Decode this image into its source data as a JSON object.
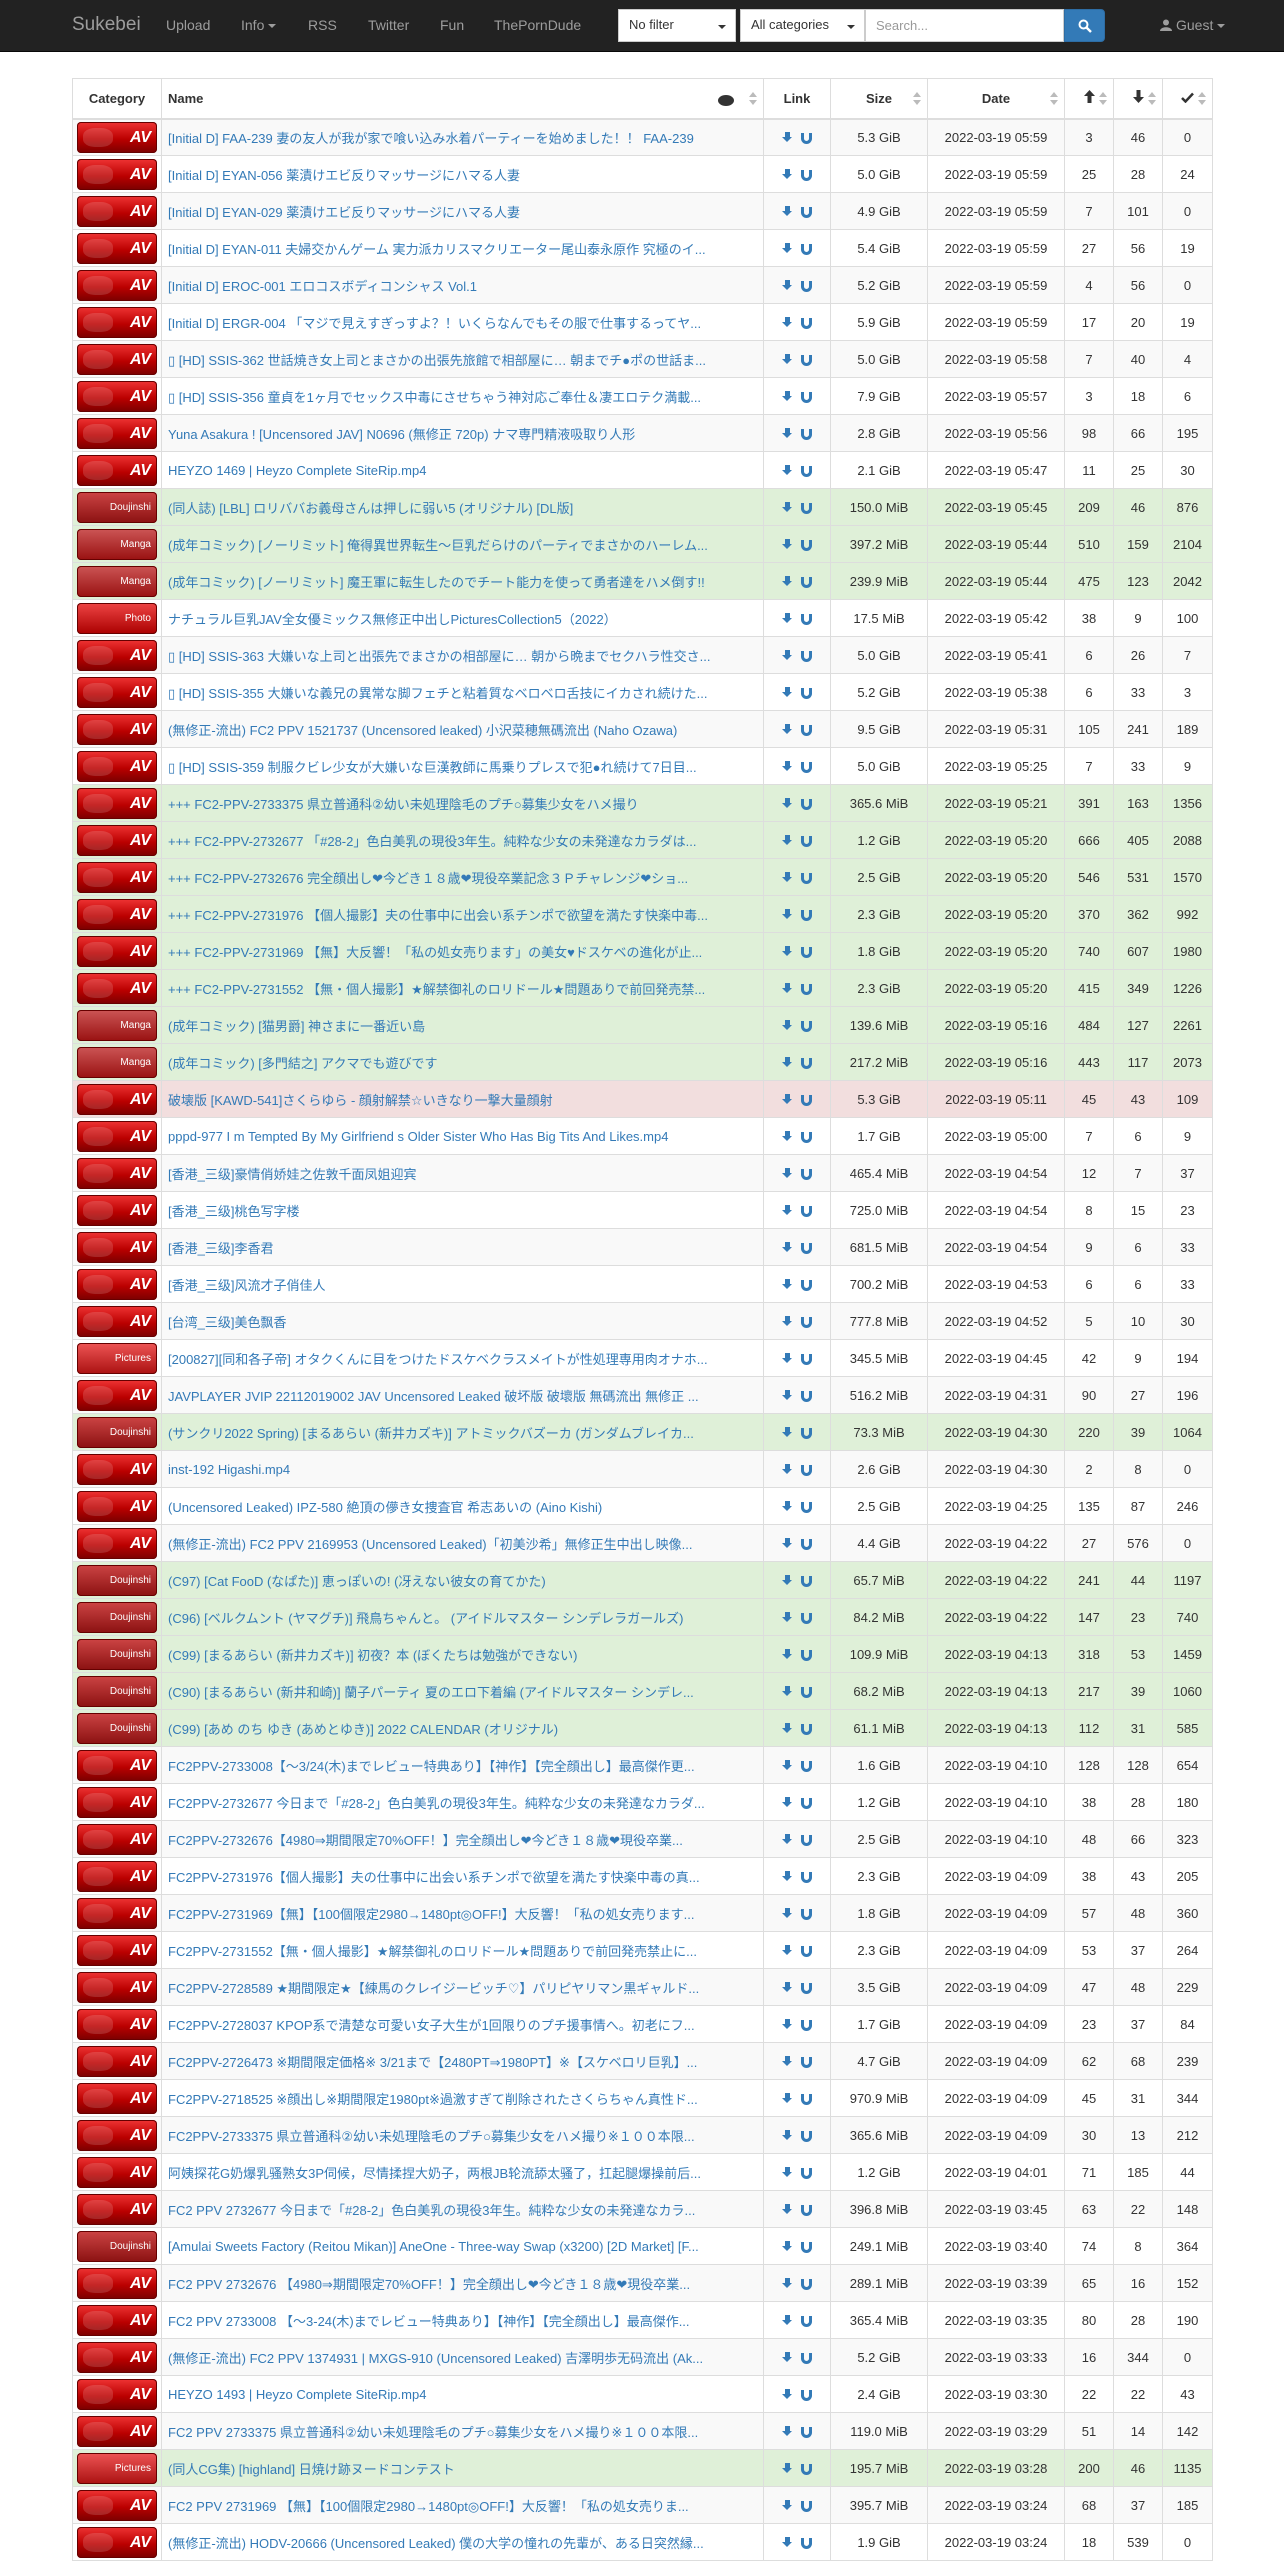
{
  "nav": {
    "brand": "Sukebei",
    "items": [
      "Upload",
      "Info",
      "RSS",
      "Twitter",
      "Fun",
      "ThePornDude"
    ],
    "filter": "No filter",
    "category": "All categories",
    "search_placeholder": "Search...",
    "user": "Guest"
  },
  "table": {
    "headers": {
      "category": "Category",
      "name": "Name",
      "link": "Link",
      "size": "Size",
      "date": "Date"
    },
    "rows": [
      {
        "cat": "AV",
        "name": "[Initial D] FAA-239 妻の友人が我が家で喰い込み水着パーティーを始めました！！ FAA-239",
        "size": "5.3 GiB",
        "date": "2022-03-19 05:59",
        "s": "3",
        "l": "46",
        "c": "0",
        "st": ""
      },
      {
        "cat": "AV",
        "name": "[Initial D] EYAN-056 薬漬けエビ反りマッサージにハマる人妻",
        "size": "5.0 GiB",
        "date": "2022-03-19 05:59",
        "s": "25",
        "l": "28",
        "c": "24",
        "st": ""
      },
      {
        "cat": "AV",
        "name": "[Initial D] EYAN-029 薬漬けエビ反りマッサージにハマる人妻",
        "size": "4.9 GiB",
        "date": "2022-03-19 05:59",
        "s": "7",
        "l": "101",
        "c": "0",
        "st": ""
      },
      {
        "cat": "AV",
        "name": "[Initial D] EYAN-011 夫婦交かんゲーム 実力派カリスマクリエーター尾山泰永原作 究極のイ...",
        "size": "5.4 GiB",
        "date": "2022-03-19 05:59",
        "s": "27",
        "l": "56",
        "c": "19",
        "st": ""
      },
      {
        "cat": "AV",
        "name": "[Initial D] EROC-001 エロコスボディコンシャス Vol.1",
        "size": "5.2 GiB",
        "date": "2022-03-19 05:59",
        "s": "4",
        "l": "56",
        "c": "0",
        "st": ""
      },
      {
        "cat": "AV",
        "name": "[Initial D] ERGR-004 「マジで見えすぎっすよ？！いくらなんでもその服で仕事するってヤ...",
        "size": "5.9 GiB",
        "date": "2022-03-19 05:59",
        "s": "17",
        "l": "20",
        "c": "19",
        "st": ""
      },
      {
        "cat": "AV",
        "name": "▯ [HD] SSIS-362 世話焼き女上司とまさかの出張先旅館で相部屋に… 朝までチ●ポの世話ま...",
        "size": "5.0 GiB",
        "date": "2022-03-19 05:58",
        "s": "7",
        "l": "40",
        "c": "4",
        "st": ""
      },
      {
        "cat": "AV",
        "name": "▯ [HD] SSIS-356 童貞を1ヶ月でセックス中毒にさせちゃう神対応ご奉仕＆凄エロテク満載...",
        "size": "7.9 GiB",
        "date": "2022-03-19 05:57",
        "s": "3",
        "l": "18",
        "c": "6",
        "st": ""
      },
      {
        "cat": "AV",
        "name": "Yuna Asakura ! [Uncensored JAV] N0696 (無修正 720p) ナマ専門精液吸取り人形",
        "size": "2.8 GiB",
        "date": "2022-03-19 05:56",
        "s": "98",
        "l": "66",
        "c": "195",
        "st": ""
      },
      {
        "cat": "AV",
        "name": "HEYZO 1469 | Heyzo Complete SiteRip.mp4",
        "size": "2.1 GiB",
        "date": "2022-03-19 05:47",
        "s": "11",
        "l": "25",
        "c": "30",
        "st": ""
      },
      {
        "cat": "Doujinshi",
        "name": "(同人誌) [LBL] ロリババお義母さんは押しに弱い5 (オリジナル) [DL版]",
        "size": "150.0 MiB",
        "date": "2022-03-19 05:45",
        "s": "209",
        "l": "46",
        "c": "876",
        "st": "success"
      },
      {
        "cat": "Manga",
        "name": "(成年コミック) [ノーリミット] 俺得異世界転生～巨乳だらけのパーティでまさかのハーレム...",
        "size": "397.2 MiB",
        "date": "2022-03-19 05:44",
        "s": "510",
        "l": "159",
        "c": "2104",
        "st": "success"
      },
      {
        "cat": "Manga",
        "name": "(成年コミック) [ノーリミット] 魔王軍に転生したのでチート能力を使って勇者達をハメ倒す!!",
        "size": "239.9 MiB",
        "date": "2022-03-19 05:44",
        "s": "475",
        "l": "123",
        "c": "2042",
        "st": "success"
      },
      {
        "cat": "Photo",
        "name": "ナチュラル巨乳JAV全女優ミックス無修正中出しPicturesCollection5（2022）",
        "size": "17.5 MiB",
        "date": "2022-03-19 05:42",
        "s": "38",
        "l": "9",
        "c": "100",
        "st": ""
      },
      {
        "cat": "AV",
        "name": "▯ [HD] SSIS-363 大嫌いな上司と出張先でまさかの相部屋に… 朝から晩までセクハラ性交さ...",
        "size": "5.0 GiB",
        "date": "2022-03-19 05:41",
        "s": "6",
        "l": "26",
        "c": "7",
        "st": ""
      },
      {
        "cat": "AV",
        "name": "▯ [HD] SSIS-355 大嫌いな義兄の異常な脚フェチと粘着質なベロベロ舌技にイカされ続けた...",
        "size": "5.2 GiB",
        "date": "2022-03-19 05:38",
        "s": "6",
        "l": "33",
        "c": "3",
        "st": ""
      },
      {
        "cat": "AV",
        "name": "(無修正-流出) FC2 PPV 1521737 (Uncensored leaked) 小沢菜穂無碼流出 (Naho Ozawa)",
        "size": "9.5 GiB",
        "date": "2022-03-19 05:31",
        "s": "105",
        "l": "241",
        "c": "189",
        "st": ""
      },
      {
        "cat": "AV",
        "name": "▯ [HD] SSIS-359 制服クビレ少女が大嫌いな巨漢教師に馬乗りプレスで犯●れ続けて7日目...",
        "size": "5.0 GiB",
        "date": "2022-03-19 05:25",
        "s": "7",
        "l": "33",
        "c": "9",
        "st": ""
      },
      {
        "cat": "AV",
        "name": "+++ FC2-PPV-2733375 県立普通科②幼い未処理陰毛のプチ○募集少女をハメ撮り",
        "size": "365.6 MiB",
        "date": "2022-03-19 05:21",
        "s": "391",
        "l": "163",
        "c": "1356",
        "st": "success"
      },
      {
        "cat": "AV",
        "name": "+++ FC2-PPV-2732677 「#28-2」色白美乳の現役3年生。純粋な少女の未発達なカラダは...",
        "size": "1.2 GiB",
        "date": "2022-03-19 05:20",
        "s": "666",
        "l": "405",
        "c": "2088",
        "st": "success"
      },
      {
        "cat": "AV",
        "name": "+++ FC2-PPV-2732676 完全顔出し❤今どき１８歳❤現役卒業記念３Ｐチャレンジ❤ショ...",
        "size": "2.5 GiB",
        "date": "2022-03-19 05:20",
        "s": "546",
        "l": "531",
        "c": "1570",
        "st": "success"
      },
      {
        "cat": "AV",
        "name": "+++ FC2-PPV-2731976 【個人撮影】夫の仕事中に出会い系チンポで欲望を満たす快楽中毒...",
        "size": "2.3 GiB",
        "date": "2022-03-19 05:20",
        "s": "370",
        "l": "362",
        "c": "992",
        "st": "success"
      },
      {
        "cat": "AV",
        "name": "+++ FC2-PPV-2731969 【無】大反響！「私の処女売ります」の美女♥ドスケベの進化が止...",
        "size": "1.8 GiB",
        "date": "2022-03-19 05:20",
        "s": "740",
        "l": "607",
        "c": "1980",
        "st": "success"
      },
      {
        "cat": "AV",
        "name": "+++ FC2-PPV-2731552 【無・個人撮影】★解禁御礼のロリドール★問題ありで前回発売禁...",
        "size": "2.3 GiB",
        "date": "2022-03-19 05:20",
        "s": "415",
        "l": "349",
        "c": "1226",
        "st": "success"
      },
      {
        "cat": "Manga",
        "name": "(成年コミック) [猫男爵] 神さまに一番近い島",
        "size": "139.6 MiB",
        "date": "2022-03-19 05:16",
        "s": "484",
        "l": "127",
        "c": "2261",
        "st": "success"
      },
      {
        "cat": "Manga",
        "name": "(成年コミック) [多門結之] アクマでも遊びです",
        "size": "217.2 MiB",
        "date": "2022-03-19 05:16",
        "s": "443",
        "l": "117",
        "c": "2073",
        "st": "success"
      },
      {
        "cat": "AV",
        "name": "破壊版 [KAWD-541]さくらゆら - 顔射解禁☆いきなり一撃大量顔射",
        "size": "5.3 GiB",
        "date": "2022-03-19 05:11",
        "s": "45",
        "l": "43",
        "c": "109",
        "st": "danger"
      },
      {
        "cat": "AV",
        "name": "pppd-977 I m Tempted By My Girlfriend s Older Sister Who Has Big Tits And Likes.mp4",
        "size": "1.7 GiB",
        "date": "2022-03-19 05:00",
        "s": "7",
        "l": "6",
        "c": "9",
        "st": ""
      },
      {
        "cat": "AV",
        "name": "[香港_三级]豪情俏娇娃之佐敦千面凤姐迎宾",
        "size": "465.4 MiB",
        "date": "2022-03-19 04:54",
        "s": "12",
        "l": "7",
        "c": "37",
        "st": ""
      },
      {
        "cat": "AV",
        "name": "[香港_三级]桃色写字楼",
        "size": "725.0 MiB",
        "date": "2022-03-19 04:54",
        "s": "8",
        "l": "15",
        "c": "23",
        "st": ""
      },
      {
        "cat": "AV",
        "name": "[香港_三级]李香君",
        "size": "681.5 MiB",
        "date": "2022-03-19 04:54",
        "s": "9",
        "l": "6",
        "c": "33",
        "st": ""
      },
      {
        "cat": "AV",
        "name": "[香港_三级]风流才子俏佳人",
        "size": "700.2 MiB",
        "date": "2022-03-19 04:53",
        "s": "6",
        "l": "6",
        "c": "33",
        "st": ""
      },
      {
        "cat": "AV",
        "name": "[台湾_三级]美色飘香",
        "size": "777.8 MiB",
        "date": "2022-03-19 04:52",
        "s": "5",
        "l": "10",
        "c": "30",
        "st": ""
      },
      {
        "cat": "Pictures",
        "name": "[200827][同和各子帝] オタクくんに目をつけたドスケベクラスメイトが性処理専用肉オナホ...",
        "size": "345.5 MiB",
        "date": "2022-03-19 04:45",
        "s": "42",
        "l": "9",
        "c": "194",
        "st": ""
      },
      {
        "cat": "AV",
        "name": "JAVPLAYER JVIP 22112019002 JAV Uncensored Leaked 破坏版 破壞版 無碼流出 無修正 ...",
        "size": "516.2 MiB",
        "date": "2022-03-19 04:31",
        "s": "90",
        "l": "27",
        "c": "196",
        "st": ""
      },
      {
        "cat": "Doujinshi",
        "name": "(サンクリ2022 Spring) [まるあらい (新井カズキ)] アトミックバズーカ (ガンダムブレイカ...",
        "size": "73.3 MiB",
        "date": "2022-03-19 04:30",
        "s": "220",
        "l": "39",
        "c": "1064",
        "st": "success"
      },
      {
        "cat": "AV",
        "name": "inst-192 Higashi.mp4",
        "size": "2.6 GiB",
        "date": "2022-03-19 04:30",
        "s": "2",
        "l": "8",
        "c": "0",
        "st": ""
      },
      {
        "cat": "AV",
        "name": "(Uncensored Leaked) IPZ-580 絶頂の儚き女捜査官 希志あいの (Aino Kishi)",
        "size": "2.5 GiB",
        "date": "2022-03-19 04:25",
        "s": "135",
        "l": "87",
        "c": "246",
        "st": ""
      },
      {
        "cat": "AV",
        "name": "(無修正-流出) FC2 PPV 2169953 (Uncensored Leaked)「初美沙希」無修正生中出し映像...",
        "size": "4.4 GiB",
        "date": "2022-03-19 04:22",
        "s": "27",
        "l": "576",
        "c": "0",
        "st": ""
      },
      {
        "cat": "Doujinshi",
        "name": "(C97) [Cat FooD (なぱた)] 恵っぽいの! (冴えない彼女の育てかた)",
        "size": "65.7 MiB",
        "date": "2022-03-19 04:22",
        "s": "241",
        "l": "44",
        "c": "1197",
        "st": "success"
      },
      {
        "cat": "Doujinshi",
        "name": "(C96) [ベルクムント (ヤマグチ)] 飛鳥ちゃんと。 (アイドルマスター シンデレラガールズ)",
        "size": "84.2 MiB",
        "date": "2022-03-19 04:22",
        "s": "147",
        "l": "23",
        "c": "740",
        "st": "success"
      },
      {
        "cat": "Doujinshi",
        "name": "(C99) [まるあらい (新井カズキ)] 初夜？本 (ぼくたちは勉強ができない)",
        "size": "109.9 MiB",
        "date": "2022-03-19 04:13",
        "s": "318",
        "l": "53",
        "c": "1459",
        "st": "success"
      },
      {
        "cat": "Doujinshi",
        "name": "(C90) [まるあらい (新井和崎)] 蘭子パーティ 夏のエロ下着編 (アイドルマスター シンデレ...",
        "size": "68.2 MiB",
        "date": "2022-03-19 04:13",
        "s": "217",
        "l": "39",
        "c": "1060",
        "st": "success"
      },
      {
        "cat": "Doujinshi",
        "name": "(C99) [あめ のち ゆき (あめとゆき)] 2022 CALENDAR (オリジナル)",
        "size": "61.1 MiB",
        "date": "2022-03-19 04:13",
        "s": "112",
        "l": "31",
        "c": "585",
        "st": "success"
      },
      {
        "cat": "AV",
        "name": "FC2PPV-2733008【〜3/24(木)までレビュー特典あり】【神作】【完全顔出し】最高傑作更...",
        "size": "1.6 GiB",
        "date": "2022-03-19 04:10",
        "s": "128",
        "l": "128",
        "c": "654",
        "st": ""
      },
      {
        "cat": "AV",
        "name": "FC2PPV-2732677 今日まで「#28-2」色白美乳の現役3年生。純粋な少女の未発達なカラダ...",
        "size": "1.2 GiB",
        "date": "2022-03-19 04:10",
        "s": "38",
        "l": "28",
        "c": "180",
        "st": ""
      },
      {
        "cat": "AV",
        "name": "FC2PPV-2732676【4980⇒期間限定70%OFF！】完全顔出し❤今どき１８歳❤現役卒業...",
        "size": "2.5 GiB",
        "date": "2022-03-19 04:10",
        "s": "48",
        "l": "66",
        "c": "323",
        "st": ""
      },
      {
        "cat": "AV",
        "name": "FC2PPV-2731976【個人撮影】夫の仕事中に出会い系チンポで欲望を満たす快楽中毒の真...",
        "size": "2.3 GiB",
        "date": "2022-03-19 04:09",
        "s": "38",
        "l": "43",
        "c": "205",
        "st": ""
      },
      {
        "cat": "AV",
        "name": "FC2PPV-2731969【無】【100個限定2980→1480pt◎OFF!】大反響！「私の処女売ります...",
        "size": "1.8 GiB",
        "date": "2022-03-19 04:09",
        "s": "57",
        "l": "48",
        "c": "360",
        "st": ""
      },
      {
        "cat": "AV",
        "name": "FC2PPV-2731552【無・個人撮影】★解禁御礼のロリドール★問題ありで前回発売禁止に...",
        "size": "2.3 GiB",
        "date": "2022-03-19 04:09",
        "s": "53",
        "l": "37",
        "c": "264",
        "st": ""
      },
      {
        "cat": "AV",
        "name": "FC2PPV-2728589 ★期間限定★【練馬のクレイジービッチ♡】パリピヤリマン黒ギャルド...",
        "size": "3.5 GiB",
        "date": "2022-03-19 04:09",
        "s": "47",
        "l": "48",
        "c": "229",
        "st": ""
      },
      {
        "cat": "AV",
        "name": "FC2PPV-2728037 KPOP系で清楚な可愛い女子大生が1回限りのプチ援事情へ。初老にフ...",
        "size": "1.7 GiB",
        "date": "2022-03-19 04:09",
        "s": "23",
        "l": "37",
        "c": "84",
        "st": ""
      },
      {
        "cat": "AV",
        "name": "FC2PPV-2726473 ※期間限定価格※ 3/21まで【2480PT⇒1980PT】※【スケベロリ巨乳】...",
        "size": "4.7 GiB",
        "date": "2022-03-19 04:09",
        "s": "62",
        "l": "68",
        "c": "239",
        "st": ""
      },
      {
        "cat": "AV",
        "name": "FC2PPV-2718525 ※顔出し※期間限定1980pt※過激すぎて削除されたさくらちゃん真性ド...",
        "size": "970.9 MiB",
        "date": "2022-03-19 04:09",
        "s": "45",
        "l": "31",
        "c": "344",
        "st": ""
      },
      {
        "cat": "AV",
        "name": "FC2PPV-2733375 県立普通科②幼い未処理陰毛のプチ○募集少女をハメ撮り※１００本限...",
        "size": "365.6 MiB",
        "date": "2022-03-19 04:09",
        "s": "30",
        "l": "13",
        "c": "212",
        "st": ""
      },
      {
        "cat": "AV",
        "name": "阿姨探花G奶爆乳骚熟女3P伺候，尽情揉捏大奶子，两根JB轮流舔太骚了，扛起腿爆操前后...",
        "size": "1.2 GiB",
        "date": "2022-03-19 04:01",
        "s": "71",
        "l": "185",
        "c": "44",
        "st": ""
      },
      {
        "cat": "AV",
        "name": "FC2 PPV 2732677 今日まで「#28-2」色白美乳の現役3年生。純粋な少女の未発達なカラ...",
        "size": "396.8 MiB",
        "date": "2022-03-19 03:45",
        "s": "63",
        "l": "22",
        "c": "148",
        "st": ""
      },
      {
        "cat": "Doujinshi",
        "name": "[Amulai Sweets Factory (Reitou Mikan)] AneOne - Three-way Swap (x3200) [2D Market] [F...",
        "size": "249.1 MiB",
        "date": "2022-03-19 03:40",
        "s": "74",
        "l": "8",
        "c": "364",
        "st": ""
      },
      {
        "cat": "AV",
        "name": "FC2 PPV 2732676 【4980⇒期間限定70%OFF！】完全顔出し❤今どき１８歳❤現役卒業...",
        "size": "289.1 MiB",
        "date": "2022-03-19 03:39",
        "s": "65",
        "l": "16",
        "c": "152",
        "st": ""
      },
      {
        "cat": "AV",
        "name": "FC2 PPV 2733008 【〜3-24(木)までレビュー特典あり】【神作】【完全顔出し】最高傑作...",
        "size": "365.4 MiB",
        "date": "2022-03-19 03:35",
        "s": "80",
        "l": "28",
        "c": "190",
        "st": ""
      },
      {
        "cat": "AV",
        "name": "(無修正-流出) FC2 PPV 1374931 | MXGS-910 (Uncensored Leaked) 吉澤明歩无码流出 (Ak...",
        "size": "5.2 GiB",
        "date": "2022-03-19 03:33",
        "s": "16",
        "l": "344",
        "c": "0",
        "st": ""
      },
      {
        "cat": "AV",
        "name": "HEYZO 1493 | Heyzo Complete SiteRip.mp4",
        "size": "2.4 GiB",
        "date": "2022-03-19 03:30",
        "s": "22",
        "l": "22",
        "c": "43",
        "st": ""
      },
      {
        "cat": "AV",
        "name": "FC2 PPV 2733375 県立普通科②幼い未処理陰毛のプチ○募集少女をハメ撮り※１００本限...",
        "size": "119.0 MiB",
        "date": "2022-03-19 03:29",
        "s": "51",
        "l": "14",
        "c": "142",
        "st": ""
      },
      {
        "cat": "Pictures",
        "name": "(同人CG集) [highland] 日焼け跡ヌードコンテスト",
        "size": "195.7 MiB",
        "date": "2022-03-19 03:28",
        "s": "200",
        "l": "46",
        "c": "1135",
        "st": "success"
      },
      {
        "cat": "AV",
        "name": "FC2 PPV 2731969 【無】【100個限定2980→1480pt◎OFF!】大反響！「私の処女売りま...",
        "size": "395.7 MiB",
        "date": "2022-03-19 03:24",
        "s": "68",
        "l": "37",
        "c": "185",
        "st": ""
      },
      {
        "cat": "AV",
        "name": "(無修正-流出) HODV-20666 (Uncensored Leaked) 僕の大学の憧れの先輩が、ある日突然縁...",
        "size": "1.9 GiB",
        "date": "2022-03-19 03:24",
        "s": "18",
        "l": "539",
        "c": "0",
        "st": ""
      }
    ]
  },
  "colors": {
    "navbar": "#222222",
    "link": "#337ab7",
    "seeders": "#3c763d",
    "leechers": "#d9534f",
    "success_row": "#dff0d8",
    "danger_row": "#f2dede"
  },
  "icons": [
    "comment-icon",
    "sort-icon",
    "arrow-up-icon",
    "arrow-down-icon",
    "check-icon",
    "download-icon",
    "magnet-icon",
    "search-icon",
    "user-icon"
  ]
}
